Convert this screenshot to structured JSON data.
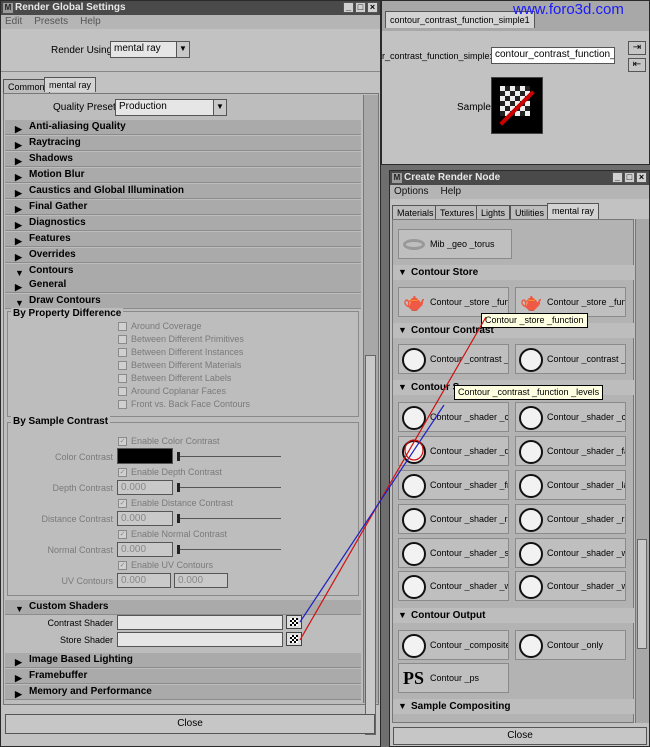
{
  "rgs": {
    "title": "Render Global Settings",
    "menu": [
      "Edit",
      "Presets",
      "Help"
    ],
    "render_using_label": "Render Using",
    "render_using_value": "mental ray",
    "tabs": [
      "Common",
      "mental ray"
    ],
    "quality_presets_label": "Quality Presets",
    "quality_presets_value": "Production",
    "frames": [
      "Anti-aliasing Quality",
      "Raytracing",
      "Shadows",
      "Motion Blur",
      "Caustics and Global Illumination",
      "Final Gather",
      "Diagnostics",
      "Features",
      "Overrides",
      "Contours",
      "General",
      "Draw Contours"
    ],
    "by_property_label": "By Property Difference",
    "property_checks": [
      "Around Coverage",
      "Between Different Primitives",
      "Between Different Instances",
      "Between Different Materials",
      "Between Different Labels",
      "Around Coplanar Faces",
      "Front vs. Back Face Contours"
    ],
    "by_sample_label": "By Sample Contrast",
    "sample_rows": {
      "enable_color": "Enable Color Contrast",
      "color_label": "Color Contrast",
      "enable_depth": "Enable Depth Contrast",
      "depth_label": "Depth Contrast",
      "depth_value": "0.000",
      "enable_distance": "Enable Distance Contrast",
      "distance_label": "Distance Contrast",
      "distance_value": "0.000",
      "enable_normal": "Enable Normal Contrast",
      "normal_label": "Normal Contrast",
      "normal_value": "0.000",
      "enable_uv": "Enable UV Contours",
      "uv_label": "UV Contours",
      "uv_value1": "0.000",
      "uv_value2": "0.000"
    },
    "custom_shaders_label": "Custom Shaders",
    "contrast_shader_label": "Contrast Shader",
    "store_shader_label": "Store Shader",
    "frames_bottom": [
      "Image Based Lighting",
      "Framebuffer",
      "Memory and Performance"
    ],
    "close_label": "Close"
  },
  "attr": {
    "tab_label": "contour_contrast_function_simple1",
    "node_label": "r_contrast_function_simple:",
    "node_value": "contour_contrast_function_simp",
    "sample_label": "Sample"
  },
  "watermark": "www.foro3d.com",
  "crn": {
    "title": "Create Render Node",
    "menu": [
      "Options",
      "Help"
    ],
    "tabs": [
      "Materials",
      "Textures",
      "Lights",
      "Utilities",
      "mental ray"
    ],
    "torus_label": "Mib _geo _torus",
    "sections": {
      "store": "Contour Store",
      "contrast": "Contour Contrast",
      "shader": "Contour S",
      "output": "Contour Output",
      "compositing": "Sample Compositing"
    },
    "store_nodes": [
      "Contour _store _func",
      "Contour _store _func"
    ],
    "contrast_nodes": [
      "Contour _contrast _fu",
      "Contour _contrast _fu"
    ],
    "shader_nodes": [
      "Contour _shader _co",
      "Contour _shader _cu",
      "Contour _shader _de",
      "Contour _shader _fac",
      "Contour _shader _fra",
      "Contour _shader _lay",
      "Contour _shader _ran",
      "Contour _shader _ran",
      "Contour _shader _sin",
      "Contour _shader _wid",
      "Contour _shader _wid",
      "Contour _shader _wid"
    ],
    "output_nodes": [
      "Contour _composite",
      "Contour _only",
      "Contour _ps"
    ],
    "ps_icon_text": "PS",
    "tooltip_store": "Contour _store _function",
    "tooltip_contrast": "Contour _contrast _function _levels",
    "close_label": "Close"
  },
  "colors": {
    "line_red": "#d01010",
    "line_blue": "#2020c0"
  }
}
